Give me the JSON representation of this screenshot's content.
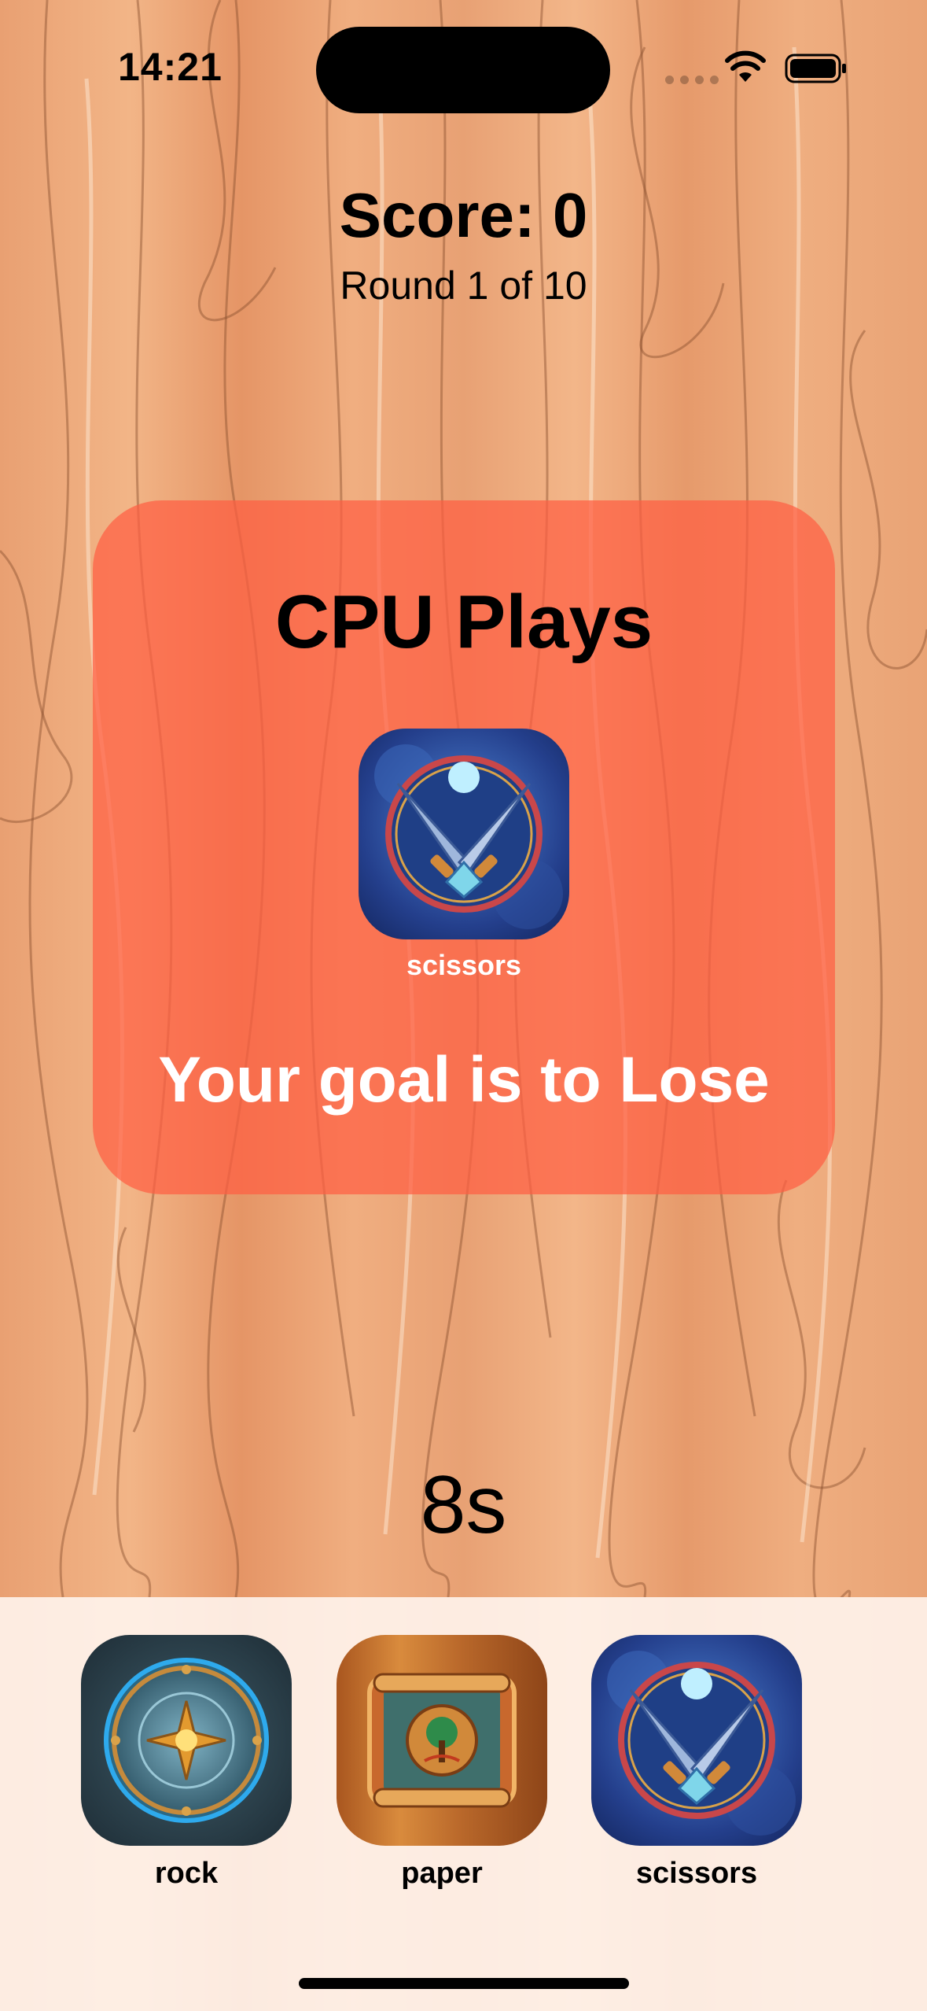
{
  "status_bar": {
    "time": "14:21",
    "icons": [
      "signal-dots-icon",
      "wifi-icon",
      "battery-icon"
    ]
  },
  "header": {
    "score_text": "Score: 0",
    "round_text": "Round 1 of 10"
  },
  "cpu_card": {
    "title": "CPU Plays",
    "move_icon": "scissors-icon",
    "move_label": "scissors",
    "goal_text": "Your goal is to Lose",
    "background_color": "#ff5e42"
  },
  "timer": {
    "text": "8s"
  },
  "choices": [
    {
      "label": "rock",
      "icon": "rock-icon"
    },
    {
      "label": "paper",
      "icon": "paper-icon"
    },
    {
      "label": "scissors",
      "icon": "scissors-icon"
    }
  ],
  "colors": {
    "wood_light": "#f2b587",
    "wood_dark": "#e59566",
    "tray": "#fff6f0"
  }
}
